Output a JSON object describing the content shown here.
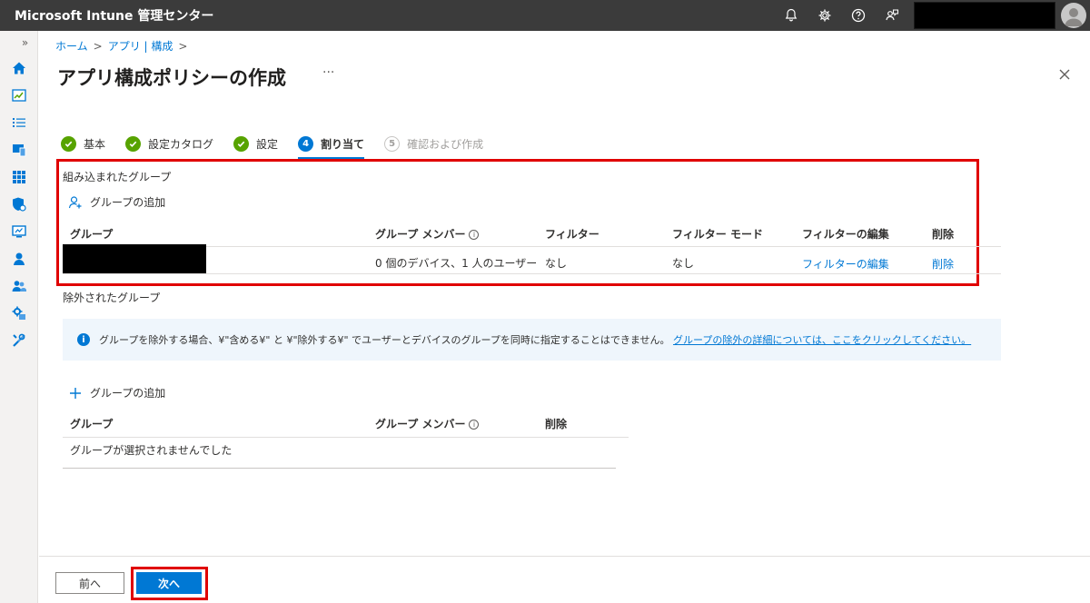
{
  "app": {
    "title": "Microsoft Intune 管理センター"
  },
  "breadcrumb": [
    {
      "label": "ホーム"
    },
    {
      "label": "アプリ | 構成"
    }
  ],
  "page": {
    "title": "アプリ構成ポリシーの作成",
    "more": "···"
  },
  "steps": [
    {
      "label": "基本",
      "state": "done"
    },
    {
      "label": "設定カタログ",
      "state": "done"
    },
    {
      "label": "設定",
      "state": "done"
    },
    {
      "number": "4",
      "label": "割り当て",
      "state": "current"
    },
    {
      "number": "5",
      "label": "確認および作成",
      "state": "disabled"
    }
  ],
  "included": {
    "title": "組み込まれたグループ",
    "add_label": "グループの追加",
    "headers": {
      "group": "グループ",
      "members": "グループ メンバー",
      "filter": "フィルター",
      "filter_mode": "フィルター モード",
      "edit_filter": "フィルターの編集",
      "delete": "削除"
    },
    "rows": [
      {
        "members": "0 個のデバイス、1 人のユーザー",
        "filter": "なし",
        "filter_mode": "なし",
        "edit_filter": "フィルターの編集",
        "delete": "削除"
      }
    ]
  },
  "excluded": {
    "title": "除外されたグループ",
    "banner_text": "グループを除外する場合、¥\"含める¥\" と ¥\"除外する¥\" でユーザーとデバイスのグループを同時に指定することはできません。",
    "banner_link": "グループの除外の詳細については、ここをクリックしてください。",
    "add_label": "グループの追加",
    "headers": {
      "group": "グループ",
      "members": "グループ メンバー",
      "delete": "削除"
    },
    "empty_text": "グループが選択されませんでした"
  },
  "footer": {
    "prev_label": "前へ",
    "next_label": "次へ"
  },
  "colors": {
    "topbar": "#3b3b3b",
    "accent": "#0078d4",
    "success": "#57a300",
    "highlight": "#e00000",
    "banner_bg": "#eff6fc"
  }
}
